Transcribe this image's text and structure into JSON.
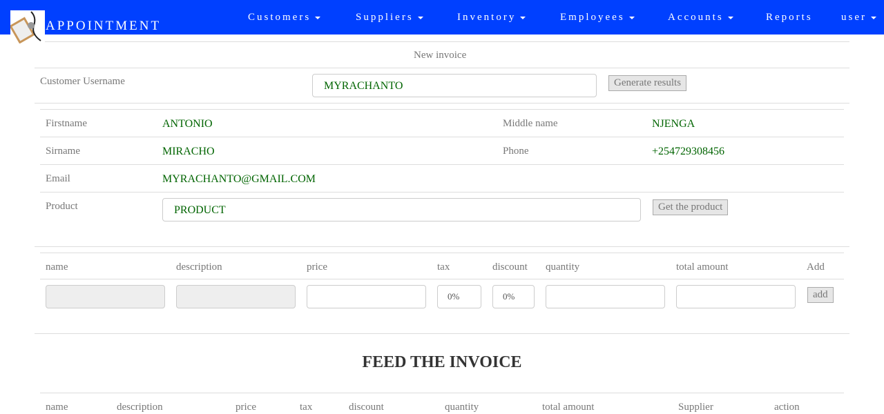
{
  "nav": {
    "brand": "APPOINTMENT",
    "items": [
      {
        "label": "Customers",
        "caret": true
      },
      {
        "label": "Suppliers",
        "caret": true
      },
      {
        "label": "Inventory",
        "caret": true
      },
      {
        "label": "Employees",
        "caret": true
      },
      {
        "label": "Accounts",
        "caret": true
      },
      {
        "label": "Reports",
        "caret": false
      },
      {
        "label": "user",
        "caret": true
      }
    ]
  },
  "form": {
    "title": "New invoice",
    "customer_label": "Customer Username",
    "customer_value": "MYRACHANTO",
    "generate_label": "Generate results"
  },
  "customer": {
    "firstname_label": "Firstname",
    "firstname": "ANTONIO",
    "middlename_label": "Middle name",
    "middlename": "NJENGA",
    "sirname_label": "Sirname",
    "sirname": "MIRACHO",
    "phone_label": "Phone",
    "phone": "+254729308456",
    "email_label": "Email",
    "email": "MYRACHANTO@GMAIL.COM",
    "product_label": "Product",
    "product_value": "PRODUCT",
    "get_product_label": "Get the product"
  },
  "item_table": {
    "headers": [
      "name",
      "description",
      "price",
      "tax",
      "discount",
      "quantity",
      "total amount",
      "Add"
    ],
    "tax_value": "0%",
    "discount_value": "0%",
    "add_label": "add"
  },
  "invoice": {
    "title": "FEED THE INVOICE",
    "headers": [
      "name",
      "description",
      "price",
      "tax",
      "discount",
      "quantity",
      "total amount",
      "Supplier",
      "action"
    ]
  }
}
